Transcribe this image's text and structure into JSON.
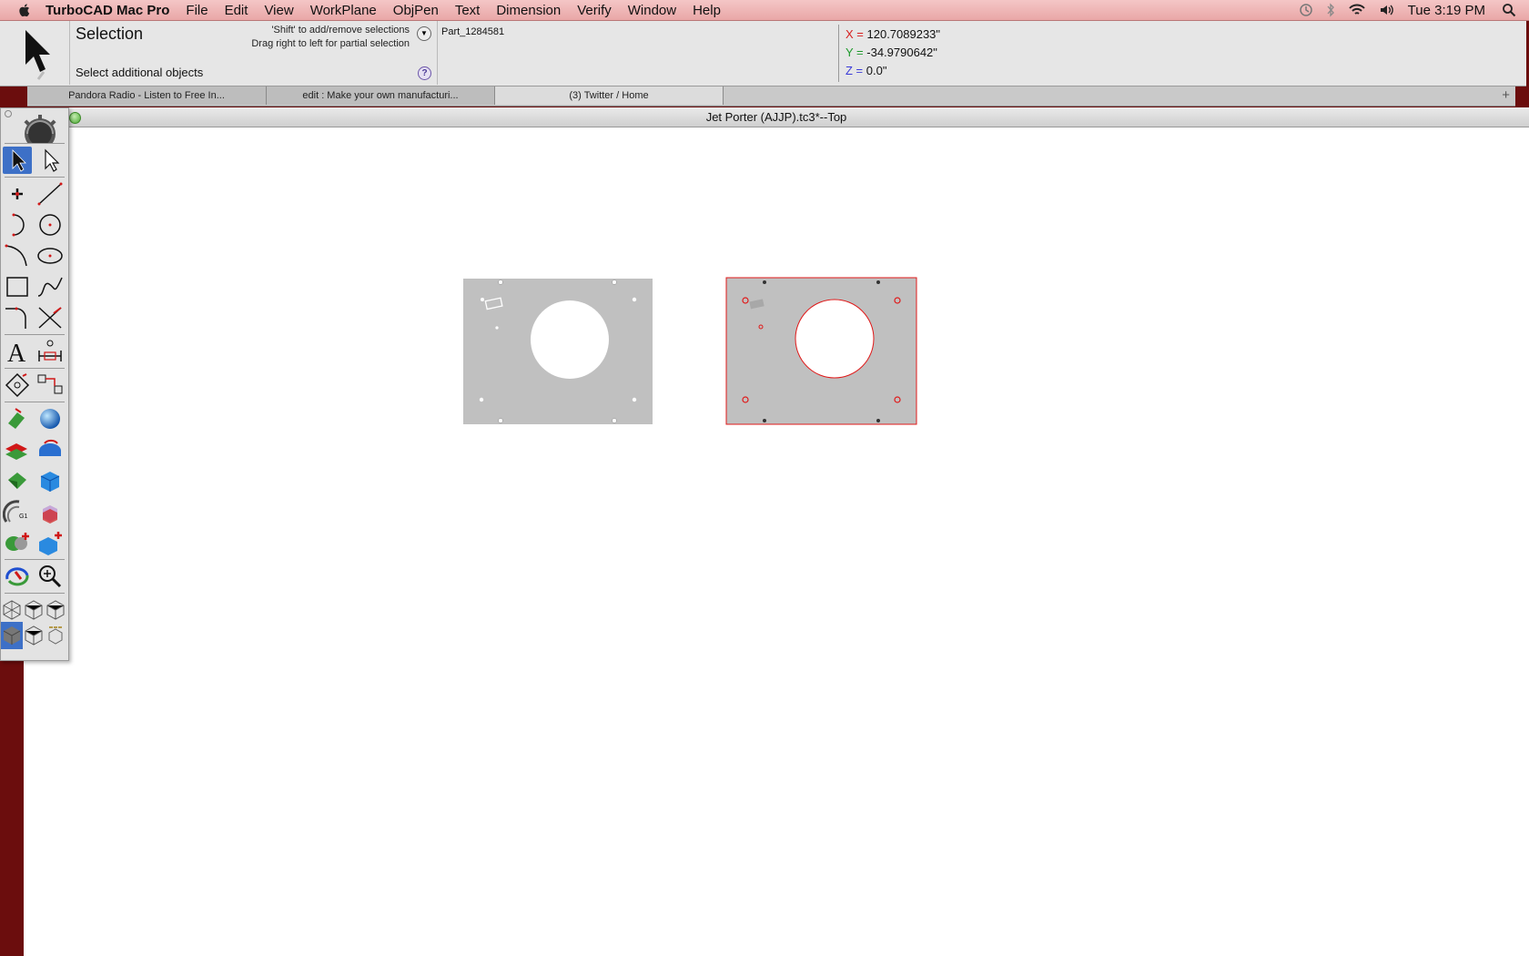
{
  "menubar": {
    "app_name": "TurboCAD Mac Pro",
    "items": [
      "File",
      "Edit",
      "View",
      "WorkPlane",
      "ObjPen",
      "Text",
      "Dimension",
      "Verify",
      "Window",
      "Help"
    ],
    "clock": "Tue 3:19 PM"
  },
  "inspector": {
    "mode_title": "Selection",
    "hint_line1": "'Shift' to add/remove selections",
    "hint_line2": "Drag right to left for partial selection",
    "prompt": "Select additional objects",
    "part_name": "Part_1284581",
    "coords": {
      "x_label": "X =",
      "x_value": "120.7089233\"",
      "y_label": "Y =",
      "y_value": "-34.9790642\"",
      "z_label": "Z =",
      "z_value": "0.0\""
    },
    "coord_colors": {
      "x": "#d62020",
      "y": "#1e9a2c",
      "z": "#3a3ad8"
    }
  },
  "tabs": [
    {
      "label": "Pandora Radio - Listen to Free In..."
    },
    {
      "label": "edit : Make your own manufacturi..."
    },
    {
      "label": "(3) Twitter / Home"
    }
  ],
  "document": {
    "title": "Jet Porter (AJJP).tc3*--Top"
  },
  "colors": {
    "menubar": "#eeb3b3",
    "desktop": "#6b0d0d",
    "part_fill": "#c0c0c0",
    "selection": "#e01818"
  },
  "toolbox": {
    "icons": [
      "gear-icon",
      "select-arrow-icon",
      "edit-arrow-icon",
      "point-icon",
      "line-icon",
      "arc-icon",
      "circle-icon",
      "curve-icon",
      "ellipse-icon",
      "rectangle-icon",
      "spline-icon",
      "fillet-icon",
      "trim-icon",
      "text-icon",
      "dimension-icon",
      "snap-icon",
      "transform-icon",
      "extrude-icon",
      "sphere-icon",
      "plane-icon",
      "revolve-icon",
      "shell-icon",
      "box-icon",
      "cam-icon",
      "boolean-icon",
      "add-solid-icon",
      "add-box-icon",
      "orbit-icon",
      "zoom-icon",
      "view-iso1-icon",
      "view-iso2-icon",
      "view-iso3-icon",
      "shaded-icon",
      "wireframe-icon",
      "hidden-line-icon"
    ]
  }
}
